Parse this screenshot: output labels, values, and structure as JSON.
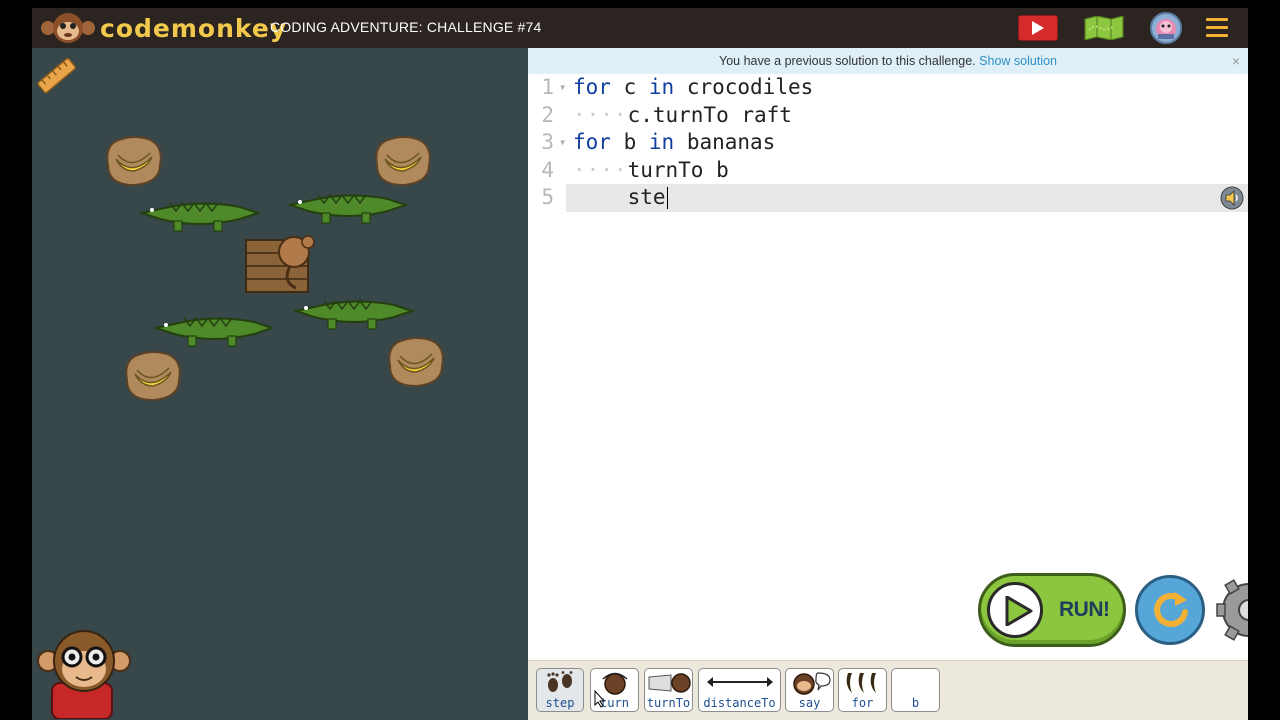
{
  "header": {
    "logo_text": "codemonkey",
    "challenge_title": "CODING ADVENTURE: CHALLENGE #74",
    "icons": [
      "video-play-icon",
      "map-icon",
      "avatar-icon",
      "menu-icon"
    ]
  },
  "notice": {
    "text": "You have a previous solution to this challenge.",
    "link": "Show solution",
    "close": "×"
  },
  "code": {
    "lines": [
      {
        "num": "1",
        "fold": true,
        "indent": "",
        "parts": [
          {
            "t": "for",
            "kw": true
          },
          {
            "t": " c "
          },
          {
            "t": "in",
            "kw": true
          },
          {
            "t": " crocodiles"
          }
        ]
      },
      {
        "num": "2",
        "fold": false,
        "indent": "····",
        "parts": [
          {
            "t": "c.turnTo raft"
          }
        ]
      },
      {
        "num": "3",
        "fold": true,
        "indent": "",
        "parts": [
          {
            "t": "for",
            "kw": true
          },
          {
            "t": " b "
          },
          {
            "t": "in",
            "kw": true
          },
          {
            "t": " bananas"
          }
        ]
      },
      {
        "num": "4",
        "fold": false,
        "indent": "····",
        "parts": [
          {
            "t": "turnTo b"
          }
        ]
      },
      {
        "num": "5",
        "fold": false,
        "indent": "    ",
        "parts": [
          {
            "t": "ste"
          }
        ],
        "active": true
      }
    ]
  },
  "buttons": {
    "run": "RUN!"
  },
  "toolbox": {
    "items": [
      {
        "label": "step",
        "icon": "footprints-icon",
        "selected": true
      },
      {
        "label": "turn",
        "icon": "monkey-head-icon"
      },
      {
        "label": "turnTo",
        "icon": "turn-to-icon"
      },
      {
        "label": "distanceTo",
        "icon": "distance-arrow-icon"
      },
      {
        "label": "say",
        "icon": "speech-icon"
      },
      {
        "label": "for",
        "icon": "bananas-icon"
      },
      {
        "label": "b",
        "icon": ""
      }
    ]
  },
  "colors": {
    "header_bg": "#2b2420",
    "water": "#37474a",
    "keyword": "#0f3f9f",
    "run_green": "#8cc63f",
    "reset_blue": "#56a7d8"
  }
}
